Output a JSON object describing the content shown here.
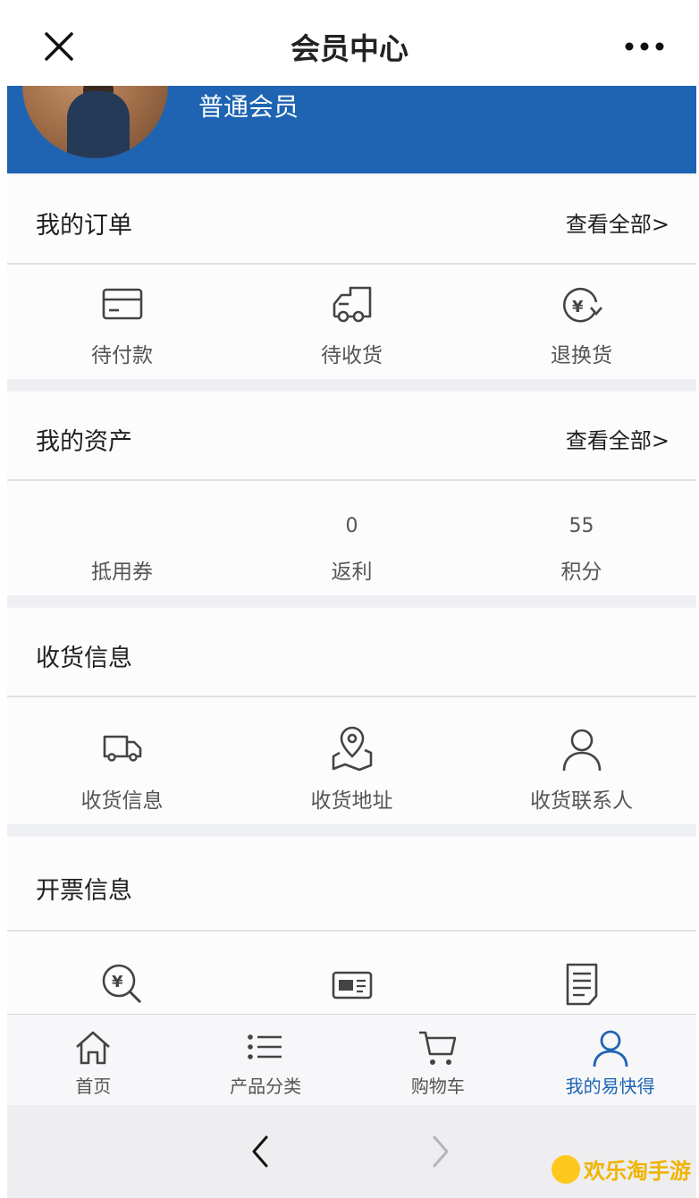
{
  "header": {
    "title": "会员中心"
  },
  "profile": {
    "level": "普通会员"
  },
  "orders": {
    "title": "我的订单",
    "view_all": "查看全部>",
    "items": [
      {
        "label": "待付款",
        "icon": "card-icon"
      },
      {
        "label": "待收货",
        "icon": "truck-icon"
      },
      {
        "label": "退换货",
        "icon": "yen-return-icon"
      }
    ]
  },
  "assets": {
    "title": "我的资产",
    "view_all": "查看全部>",
    "items": [
      {
        "label": "抵用券",
        "value": ""
      },
      {
        "label": "返利",
        "value": "0"
      },
      {
        "label": "积分",
        "value": "55"
      }
    ]
  },
  "shipping": {
    "title": "收货信息",
    "items": [
      {
        "label": "收货信息",
        "icon": "delivery-truck-icon"
      },
      {
        "label": "收货地址",
        "icon": "map-pin-icon"
      },
      {
        "label": "收货联系人",
        "icon": "person-icon"
      }
    ]
  },
  "invoice": {
    "title": "开票信息",
    "items": [
      {
        "icon": "yen-search-icon"
      },
      {
        "icon": "ticket-icon"
      },
      {
        "icon": "document-icon"
      }
    ]
  },
  "tabbar": {
    "items": [
      {
        "label": "首页",
        "icon": "home-icon"
      },
      {
        "label": "产品分类",
        "icon": "list-icon"
      },
      {
        "label": "购物车",
        "icon": "cart-icon"
      },
      {
        "label": "我的易快得",
        "icon": "user-icon",
        "active": true
      }
    ]
  },
  "watermark": {
    "text": "欢乐淘手游"
  },
  "colors": {
    "brand": "#1e64b3",
    "banner": "#1e64b3",
    "watermark": "#f0b400"
  }
}
